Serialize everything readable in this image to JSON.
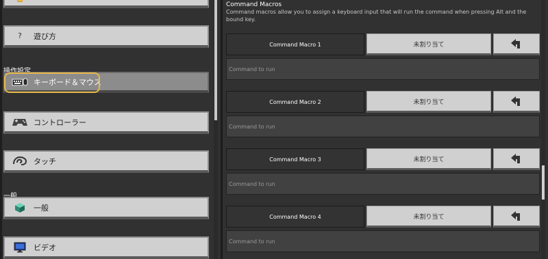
{
  "left": {
    "sections": {
      "controls": "操作設定",
      "general": "一般"
    },
    "items": [
      {
        "label": "遊び方",
        "icon": "question-icon"
      },
      {
        "label": "キーボード＆マウス",
        "icon": "keyboard-mouse-icon"
      },
      {
        "label": "コントローラー",
        "icon": "gamepad-icon"
      },
      {
        "label": "タッチ",
        "icon": "touch-icon"
      },
      {
        "label": "一般",
        "icon": "cube-icon"
      },
      {
        "label": "ビデオ",
        "icon": "monitor-icon"
      }
    ],
    "help_glyph": "?"
  },
  "right": {
    "section_title": "Command Macros",
    "section_desc": "Command macros allow you to assign a keyboard input that will run the command when pressing Alt and the bound key.",
    "macros": [
      {
        "name": "Command Macro 1",
        "binding": "未割り当て",
        "placeholder": "Command to run"
      },
      {
        "name": "Command Macro 2",
        "binding": "未割り当て",
        "placeholder": "Command to run"
      },
      {
        "name": "Command Macro 3",
        "binding": "未割り当て",
        "placeholder": "Command to run"
      },
      {
        "name": "Command Macro 4",
        "binding": "未割り当て",
        "placeholder": "Command to run"
      }
    ]
  },
  "colors": {
    "focus": "#e8b94a",
    "button": "#d0d0d0",
    "background": "#313131"
  }
}
